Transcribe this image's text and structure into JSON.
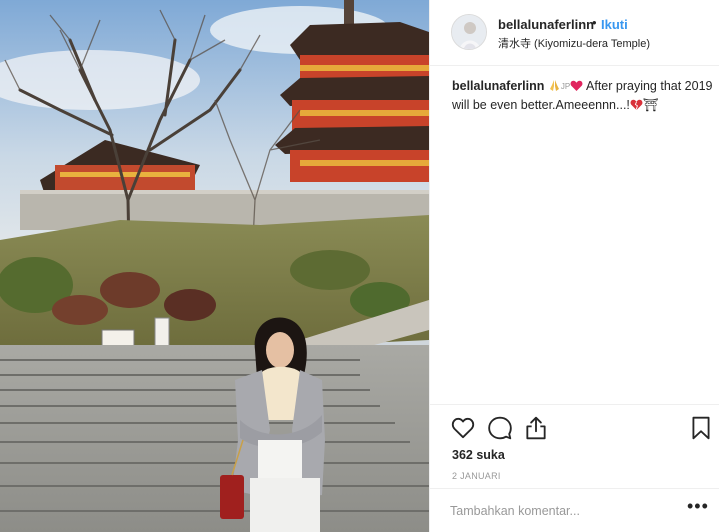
{
  "post": {
    "username": "bellalunaferlinn",
    "separator": "•",
    "follow_label": "Ikuti",
    "location": "清水寺 (Kiyomizu-dera Temple)",
    "caption": {
      "username": "bellalunaferlinn",
      "flag_text": "JP",
      "text": "After praying that 2019 will be even better.Ameeennn...!",
      "end_symbol": "⛩"
    },
    "likes": "362 suka",
    "date": "2 JANUARI",
    "comment_placeholder": "Tambahkan komentar...",
    "more_label": "•••"
  },
  "icons": {
    "like": "heart-outline-icon",
    "comment": "comment-bubble-icon",
    "share": "share-upload-icon",
    "save": "bookmark-icon",
    "caption_emojis": [
      "praying-hands-icon",
      "red-heart-icon",
      "broken-heart-icon"
    ]
  },
  "colors": {
    "link_blue": "#3897f0",
    "text": "#262626",
    "muted": "#999999",
    "border": "#efefef",
    "temple_red": "#c0432b",
    "sky": "#8fb6de"
  }
}
